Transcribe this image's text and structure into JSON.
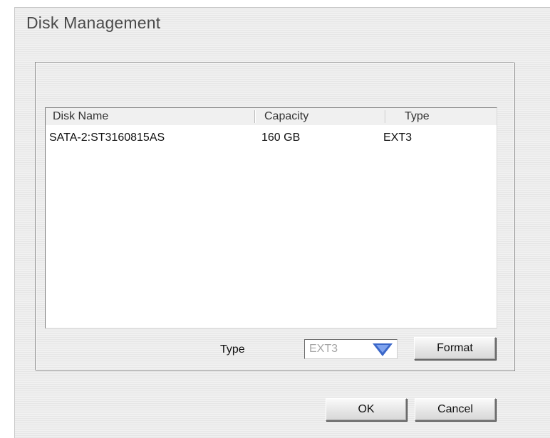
{
  "dialog": {
    "title": "Disk Management"
  },
  "disk_list": {
    "columns": [
      "Disk Name",
      "Capacity",
      "Type"
    ],
    "rows": [
      {
        "disk_name": "SATA-2:ST3160815AS",
        "capacity": "160 GB",
        "type": "EXT3"
      }
    ]
  },
  "format_controls": {
    "type_label": "Type",
    "type_select_value": "EXT3",
    "format_button": "Format"
  },
  "footer": {
    "ok_button": "OK",
    "cancel_button": "Cancel"
  },
  "colors": {
    "dropdown_arrow": "#3a67c9",
    "title_text": "#4a4a4a"
  },
  "icons": {
    "dropdown": "chevron-down-icon"
  }
}
